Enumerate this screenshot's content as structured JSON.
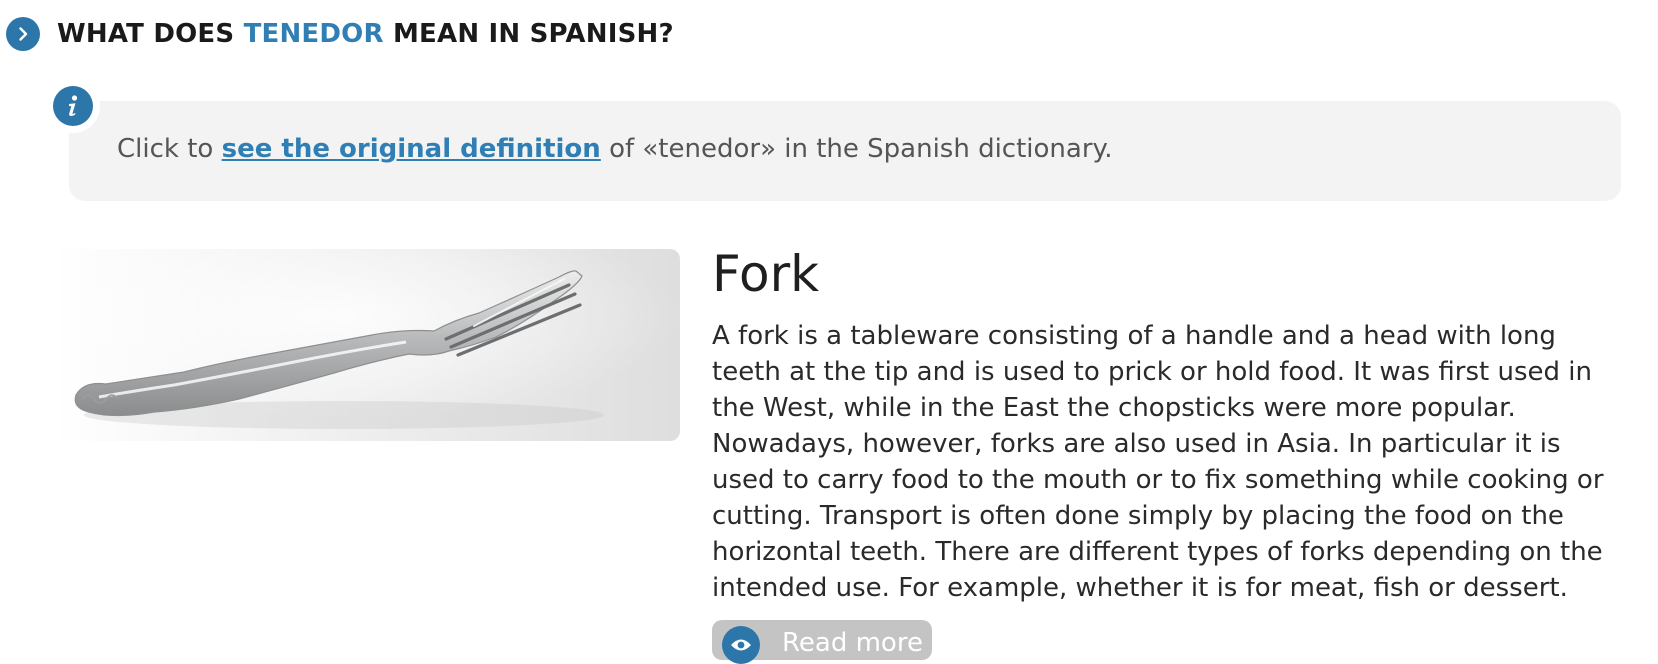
{
  "heading": {
    "prefix": "WHAT DOES",
    "word": "TENEDOR",
    "suffix": "MEAN IN SPANISH?"
  },
  "info": {
    "lead": "Click to",
    "link_text": "see the original definition",
    "tail": "of «tenedor» in the Spanish dictionary."
  },
  "entry": {
    "title": "Fork",
    "body": "A fork is a tableware consisting of a handle and a head with long teeth at the tip and is used to prick or hold food. It was first used in the West, while in the East the chopsticks were more popular. Nowadays, however, forks are also used in Asia. In particular it is used to carry food to the mouth or to fix something while cooking or cutting. Transport is often done simply by placing the food on the horizontal teeth. There are different types of forks depending on the intended use. For example, whether it is for meat, fish or dessert.",
    "read_more_label": "Read more"
  },
  "icons": {
    "heading": "chevron-right-icon",
    "info": "info-icon",
    "read_more": "eye-icon"
  },
  "colors": {
    "accent": "#2f7fb5",
    "icon_circle": "#2d76aa",
    "info_background": "#f3f3f3",
    "button_background": "#c4c4c4"
  }
}
